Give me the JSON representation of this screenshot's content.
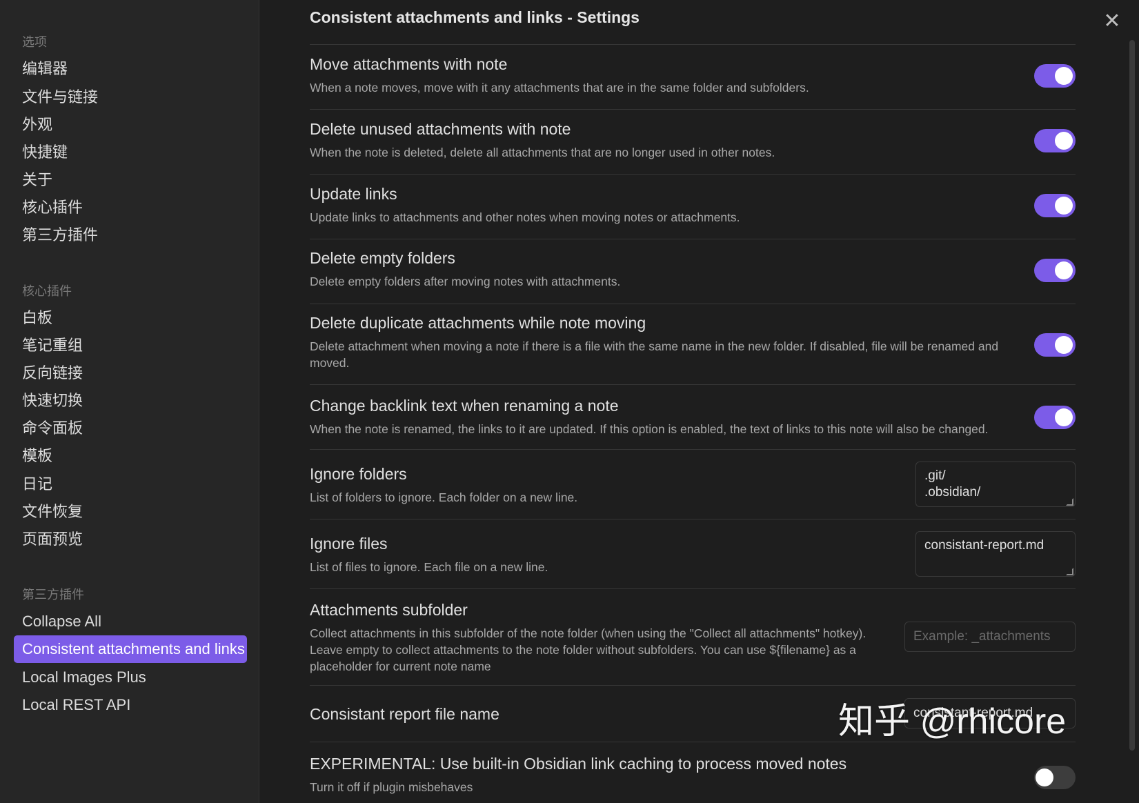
{
  "sidebar": {
    "heading_options": "选项",
    "options": [
      "编辑器",
      "文件与链接",
      "外观",
      "快捷键",
      "关于",
      "核心插件",
      "第三方插件"
    ],
    "heading_core": "核心插件",
    "core_plugins": [
      "白板",
      "笔记重组",
      "反向链接",
      "快速切换",
      "命令面板",
      "模板",
      "日记",
      "文件恢复",
      "页面预览"
    ],
    "heading_third": "第三方插件",
    "third_party": [
      "Collapse All",
      "Consistent attachments and links",
      "Local Images Plus",
      "Local REST API"
    ],
    "active_item": "Consistent attachments and links"
  },
  "main": {
    "title": "Consistent attachments and links - Settings",
    "close_icon": "close-icon",
    "settings": [
      {
        "name": "Move attachments with note",
        "desc": "When a note moves, move with it any attachments that are in the same folder and subfolders.",
        "control": "toggle",
        "value": true
      },
      {
        "name": "Delete unused attachments with note",
        "desc": "When the note is deleted, delete all attachments that are no longer used in other notes.",
        "control": "toggle",
        "value": true
      },
      {
        "name": "Update links",
        "desc": "Update links to attachments and other notes when moving notes or attachments.",
        "control": "toggle",
        "value": true
      },
      {
        "name": "Delete empty folders",
        "desc": "Delete empty folders after moving notes with attachments.",
        "control": "toggle",
        "value": true
      },
      {
        "name": "Delete duplicate attachments while note moving",
        "desc": "Delete attachment when moving a note if there is a file with the same name in the new folder. If disabled, file will be renamed and moved.",
        "control": "toggle",
        "value": true
      },
      {
        "name": "Change backlink text when renaming a note",
        "desc": "When the note is renamed, the links to it are updated. If this option is enabled, the text of links to this note will also be changed.",
        "control": "toggle",
        "value": true
      },
      {
        "name": "Ignore folders",
        "desc": "List of folders to ignore. Each folder on a new line.",
        "control": "textarea",
        "value": ".git/\n.obsidian/"
      },
      {
        "name": "Ignore files",
        "desc": "List of files to ignore. Each file on a new line.",
        "control": "textarea",
        "value": "consistant-report.md"
      },
      {
        "name": "Attachments subfolder",
        "desc": "Collect attachments in this subfolder of the note folder (when using the \"Collect all attachments\" hotkey). Leave empty to collect attachments to the note folder without subfolders. You can use ${filename} as a placeholder for current note name",
        "control": "text",
        "value": "",
        "placeholder": "Example: _attachments"
      },
      {
        "name": "Consistant report file name",
        "desc": "",
        "control": "text",
        "value": "consistant-report.md",
        "placeholder": ""
      },
      {
        "name": "EXPERIMENTAL: Use built-in Obsidian link caching to process moved notes",
        "desc": "Turn it off if plugin misbehaves",
        "control": "toggle",
        "value": false
      }
    ]
  },
  "watermark": "知乎 @rhicore",
  "colors": {
    "accent": "#7c5ce8",
    "background": "#1e1e1e",
    "sidebar": "#262626"
  }
}
